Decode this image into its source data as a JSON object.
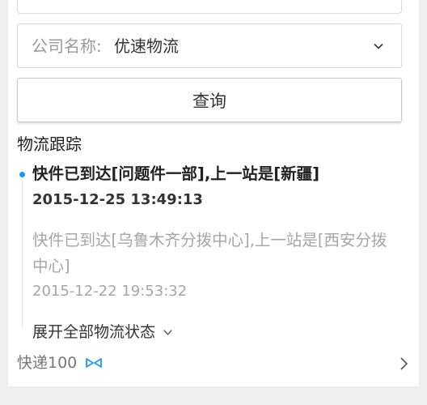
{
  "form": {
    "company_label": "公司名称:",
    "company_value": "优速物流",
    "query_button": "查询"
  },
  "tracking": {
    "title": "物流跟踪",
    "entries": [
      {
        "text": "快件已到达[问题件一部],上一站是[新疆]",
        "time": "2015-12-25 13:49:13"
      },
      {
        "text": "快件已到达[乌鲁木齐分拨中心],上一站是[西安分拨中心]",
        "time": "2015-12-22 19:53:32"
      }
    ],
    "expand_label": "展开全部物流状态"
  },
  "footer": {
    "brand": "快递100"
  },
  "colors": {
    "accent": "#2196f3",
    "muted": "#a6a6a6"
  }
}
